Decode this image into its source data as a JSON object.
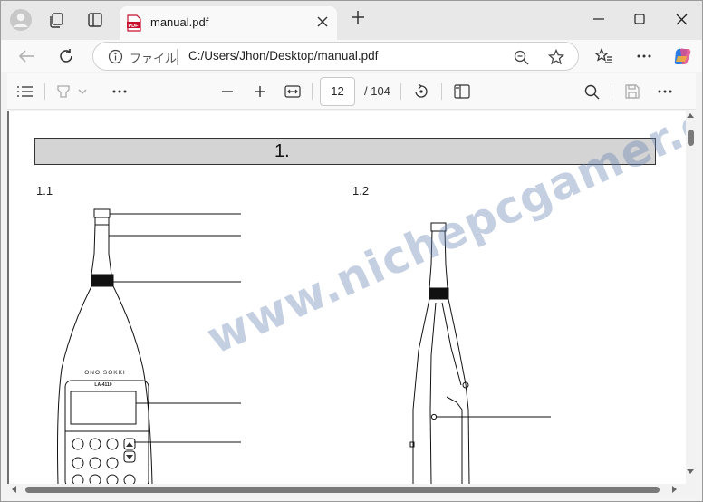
{
  "browser": {
    "tab": {
      "title": "manual.pdf",
      "badge": "PDF"
    },
    "address": {
      "scheme_label": "ファイル",
      "url": "C:/Users/Jhon/Desktop/manual.pdf"
    }
  },
  "icons": {
    "profile": "profile-icon",
    "workspaces": "workspaces-icon",
    "tab_actions": "tab-actions-icon",
    "back": "back-arrow-icon",
    "refresh": "refresh-icon",
    "info": "info-icon",
    "zoom_out": "zoom-out-icon",
    "favorite": "star-icon",
    "favorites_list": "favorites-icon",
    "more": "more-icon",
    "copilot": "copilot-icon"
  },
  "pdf_toolbar": {
    "current_page": "12",
    "total_pages": "/ 104"
  },
  "document": {
    "chapter_heading": "1.",
    "section_left": "1.1",
    "section_right": "1.2",
    "device_brand": "ONO SOKKI",
    "device_model": "LA-4110"
  },
  "watermark": "www.nichepcgamer.com"
}
